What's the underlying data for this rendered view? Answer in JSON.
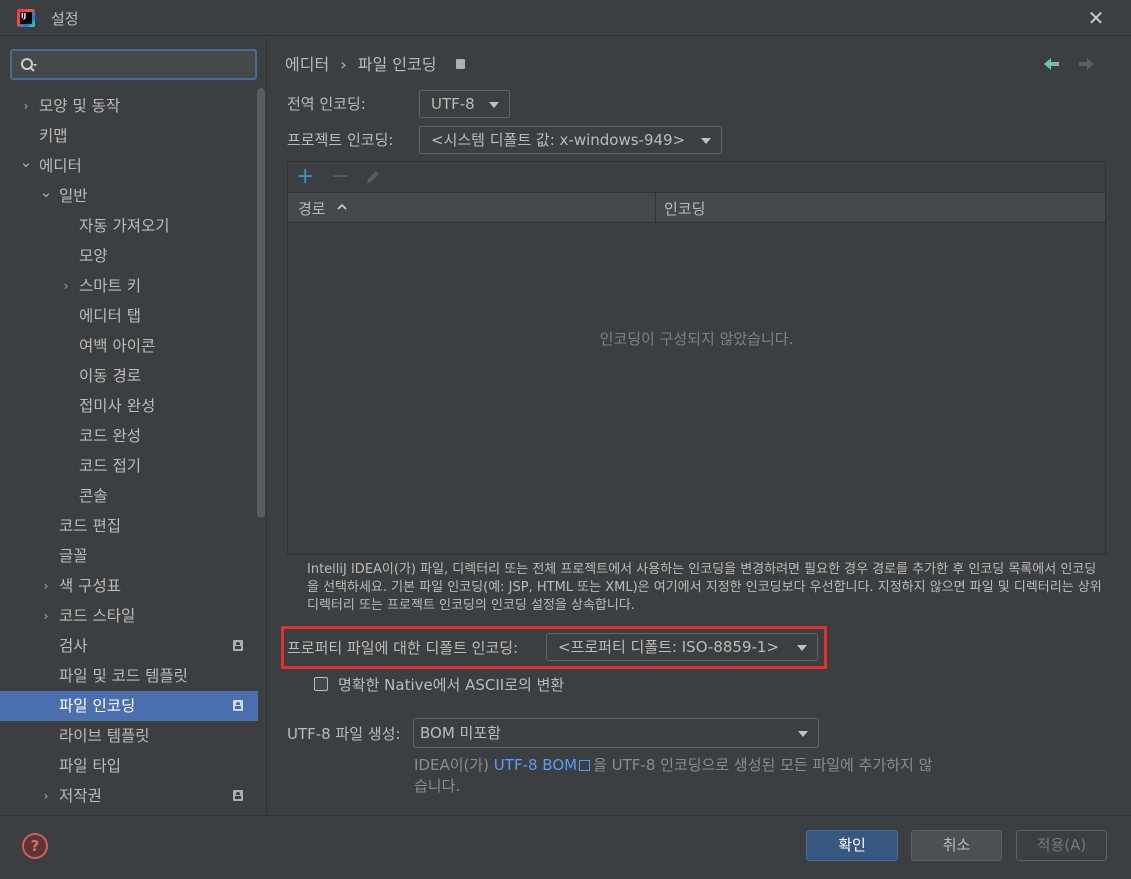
{
  "window": {
    "title": "설정",
    "close_glyph": "✕",
    "app_icon_text": "IJ"
  },
  "search": {
    "placeholder": ""
  },
  "sidebar": {
    "items": [
      {
        "label": "모양 및 동작",
        "chevron": "›"
      },
      {
        "label": "키맵"
      },
      {
        "label": "에디터",
        "chevron": "⌄"
      },
      {
        "label": "일반",
        "chevron": "⌄"
      },
      {
        "label": "자동 가져오기"
      },
      {
        "label": "모양"
      },
      {
        "label": "스마트 키",
        "chevron": "›"
      },
      {
        "label": "에디터 탭"
      },
      {
        "label": "여백 아이콘"
      },
      {
        "label": "이동 경로"
      },
      {
        "label": "접미사 완성"
      },
      {
        "label": "코드 완성"
      },
      {
        "label": "코드 접기"
      },
      {
        "label": "콘솔"
      },
      {
        "label": "코드 편집"
      },
      {
        "label": "글꼴"
      },
      {
        "label": "색 구성표",
        "chevron": "›"
      },
      {
        "label": "코드 스타일",
        "chevron": "›"
      },
      {
        "label": "검사"
      },
      {
        "label": "파일 및 코드 템플릿"
      },
      {
        "label": "파일 인코딩"
      },
      {
        "label": "라이브 템플릿"
      },
      {
        "label": "파일 타입"
      },
      {
        "label": "저작권",
        "chevron": "›"
      }
    ]
  },
  "breadcrumb": {
    "parent": "에디터",
    "separator": "›",
    "current": "파일 인코딩"
  },
  "global_encoding": {
    "label": "전역 인코딩:",
    "value": "UTF-8"
  },
  "project_encoding": {
    "label": "프로젝트 인코딩:",
    "value": "<시스템 디폴트 값: x-windows-949>"
  },
  "table": {
    "toolbar": {
      "add": "+",
      "remove": "−"
    },
    "columns": [
      "경로",
      "인코딩"
    ],
    "empty_text": "인코딩이 구성되지 않았습니다."
  },
  "description": "IntelliJ IDEA이(가) 파일, 디렉터리 또는 전체 프로젝트에서 사용하는 인코딩을 변경하려면 필요한 경우 경로를 추가한 후 인코딩 목록에서 인코딩을 선택하세요. 기본 파일 인코딩(예: JSP, HTML 또는 XML)은 여기에서 지정한 인코딩보다 우선합니다. 지정하지 않으면 파일 및 디렉터리는 상위 디렉터리 또는 프로젝트 인코딩의 인코딩 설정을 상속합니다.",
  "properties_encoding": {
    "label": "프로퍼티 파일에 대한 디폴트 인코딩:",
    "value": "<프로퍼티 디폴트: ISO-8859-1>"
  },
  "native_to_ascii": {
    "label": "명확한 Native에서 ASCII로의 변환",
    "checked": false
  },
  "utf8_bom": {
    "label": "UTF-8 파일 생성:",
    "value": "BOM 미포함",
    "desc_prefix": "IDEA이(가) ",
    "desc_link": "UTF-8 BOM",
    "desc_suffix": "을 UTF-8 인코딩으로 생성된 모든 파일에 추가하지 않",
    "desc_line2": "습니다."
  },
  "buttons": {
    "help": "?",
    "ok": "확인",
    "cancel": "취소",
    "apply": "적용(A)"
  },
  "colors": {
    "accent": "#4b6eaf",
    "highlight": "#e53030",
    "link": "#589df6"
  }
}
